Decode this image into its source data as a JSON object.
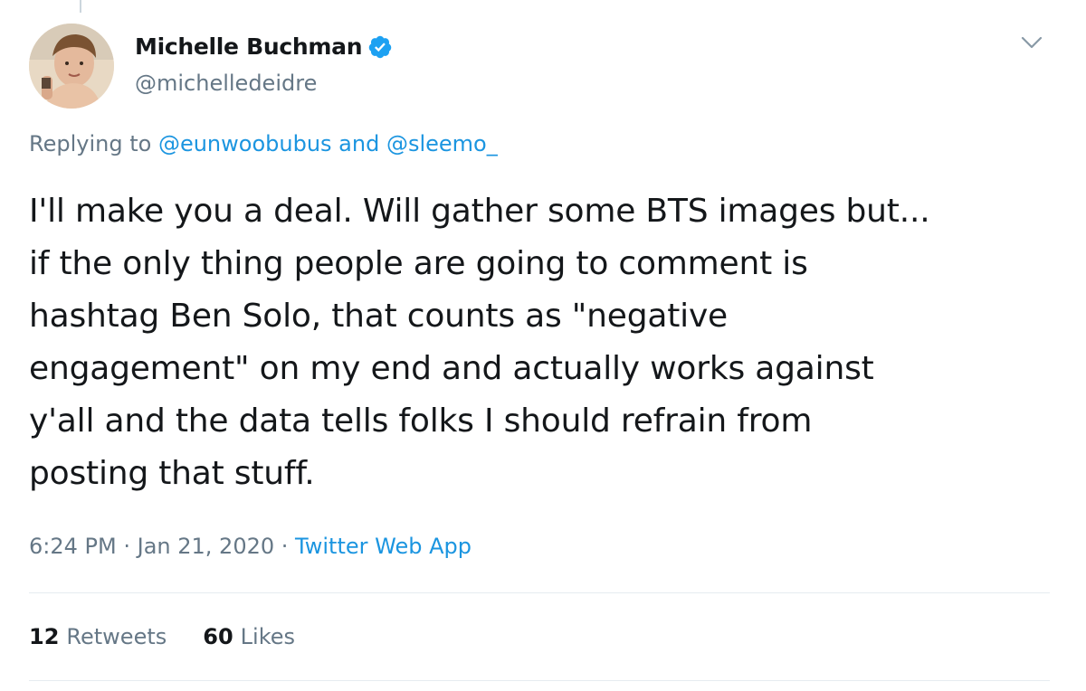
{
  "author": {
    "display_name": "Michelle Buchman",
    "handle": "@michelledeidre",
    "verified": true
  },
  "reply_context": {
    "prefix": "Replying to",
    "mention_1": "@eunwoobubus",
    "joiner": "and",
    "mention_2": "@sleemo_"
  },
  "tweet": {
    "lines": [
      "I'll make you a deal. Will gather some BTS images but...",
      "if the only thing people are going to comment is",
      "hashtag Ben Solo, that counts as \"negative",
      "engagement\" on my end and actually works against",
      "y'all and the data tells folks I should refrain from",
      "posting that stuff."
    ]
  },
  "meta": {
    "time": "6:24 PM",
    "separator": "·",
    "date": "Jan 21, 2020",
    "source": "Twitter Web App"
  },
  "stats": {
    "retweets_count": "12",
    "retweets_label": "Retweets",
    "likes_count": "60",
    "likes_label": "Likes"
  },
  "icons": {
    "verified": "verified-badge-icon",
    "caret": "chevron-down-icon"
  },
  "colors": {
    "link": "#1b95e0",
    "secondary_text": "#657786",
    "verified": "#1da1f2"
  }
}
